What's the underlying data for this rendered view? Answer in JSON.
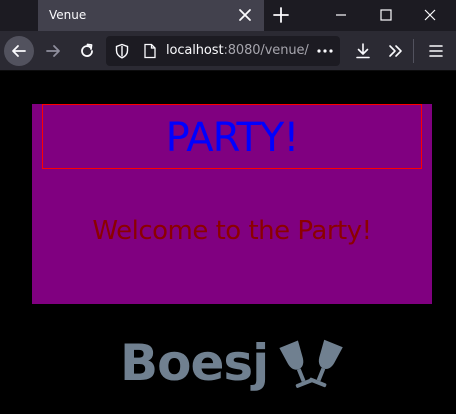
{
  "browser": {
    "tab_title": "Venue",
    "url": {
      "host": "localhost",
      "rest": ":8080/venue/"
    },
    "icons": {
      "close_tab": "close-icon",
      "new_tab": "plus-icon",
      "minimize": "minimize-icon",
      "maximize": "maximize-icon",
      "close_window": "close-icon",
      "back": "arrow-left-icon",
      "forward": "arrow-right-icon",
      "reload": "reload-icon",
      "tracking": "shield-icon",
      "page_info": "page-icon",
      "page_actions": "more-icon",
      "downloads": "download-icon",
      "overflow": "chevron-double-right-icon",
      "menu": "hamburger-icon"
    }
  },
  "page": {
    "heading": "PARTY!",
    "welcome": "Welcome to the Party!",
    "brand": "Boesj",
    "brand_icon": "clinking-glasses-icon",
    "colors": {
      "background": "#000000",
      "box": "#800080",
      "heading": "#0000ff",
      "heading_border": "#ff0000",
      "welcome": "#8b0000",
      "brand": "#708090"
    }
  }
}
